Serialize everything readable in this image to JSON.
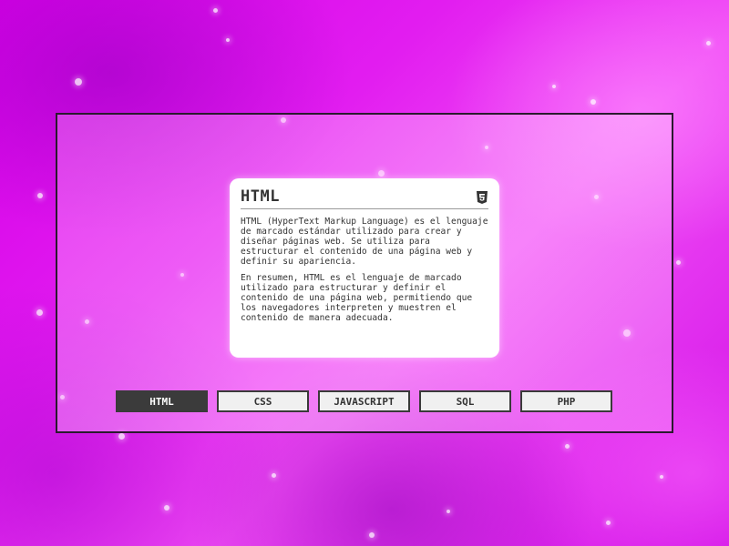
{
  "card": {
    "title": "HTML",
    "icon": "html5-icon",
    "paragraph1": "HTML (HyperText Markup Language) es el lenguaje de marcado estándar utilizado para crear y diseñar páginas web. Se utiliza para estructurar el contenido de una página web y definir su apariencia.",
    "paragraph2": "En resumen, HTML es el lenguaje de marcado utilizado para estructurar y definir el contenido de una página web, permitiendo que los navegadores interpreten y muestren el contenido de manera adecuada."
  },
  "tabs": [
    {
      "label": "HTML",
      "active": true
    },
    {
      "label": "CSS",
      "active": false
    },
    {
      "label": "JAVASCRIPT",
      "active": false
    },
    {
      "label": "SQL",
      "active": false
    },
    {
      "label": "PHP",
      "active": false
    }
  ],
  "colors": {
    "background_primary": "#e21df0",
    "active_tab": "#3b3b3b",
    "inactive_tab": "#f0f0f0",
    "card": "#ffffff"
  }
}
